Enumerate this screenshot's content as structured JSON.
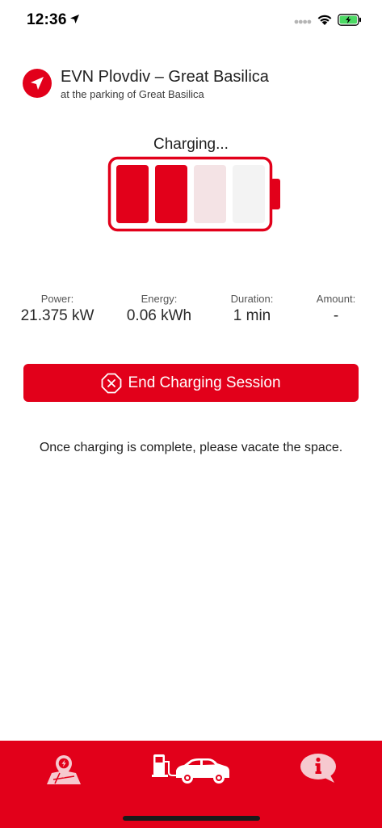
{
  "status_bar": {
    "time": "12:36",
    "icons": [
      "location-arrow-icon",
      "signal-dots-icon",
      "wifi-icon",
      "battery-charging-icon"
    ]
  },
  "station": {
    "icon": "navigation-arrow-icon",
    "name": "EVN Plovdiv – Great Basilica",
    "address": "at the parking of Great Basilica"
  },
  "charging": {
    "status_label": "Charging...",
    "battery_segments_filled": 2,
    "battery_segments_total": 4
  },
  "stats": [
    {
      "label": "Power:",
      "value": "21.375 kW"
    },
    {
      "label": "Energy:",
      "value": "0.06 kWh"
    },
    {
      "label": "Duration:",
      "value": "1 min"
    },
    {
      "label": "Amount:",
      "value": "-"
    }
  ],
  "end_button": {
    "icon": "stop-octagon-icon",
    "label": "End Charging Session"
  },
  "vacate_note": "Once charging is complete, please vacate the space.",
  "tabs": [
    {
      "id": "map",
      "icon": "charging-map-icon",
      "active": false
    },
    {
      "id": "session",
      "icon": "charging-car-icon",
      "active": true
    },
    {
      "id": "info",
      "icon": "info-bubble-icon",
      "active": false
    }
  ],
  "colors": {
    "brand_red": "#e2001a",
    "segment_empty_light": "#f4e3e5",
    "segment_empty_lighter": "#f3f3f3",
    "tab_inactive": "#f6c9cf",
    "tab_active": "#ffffff"
  }
}
